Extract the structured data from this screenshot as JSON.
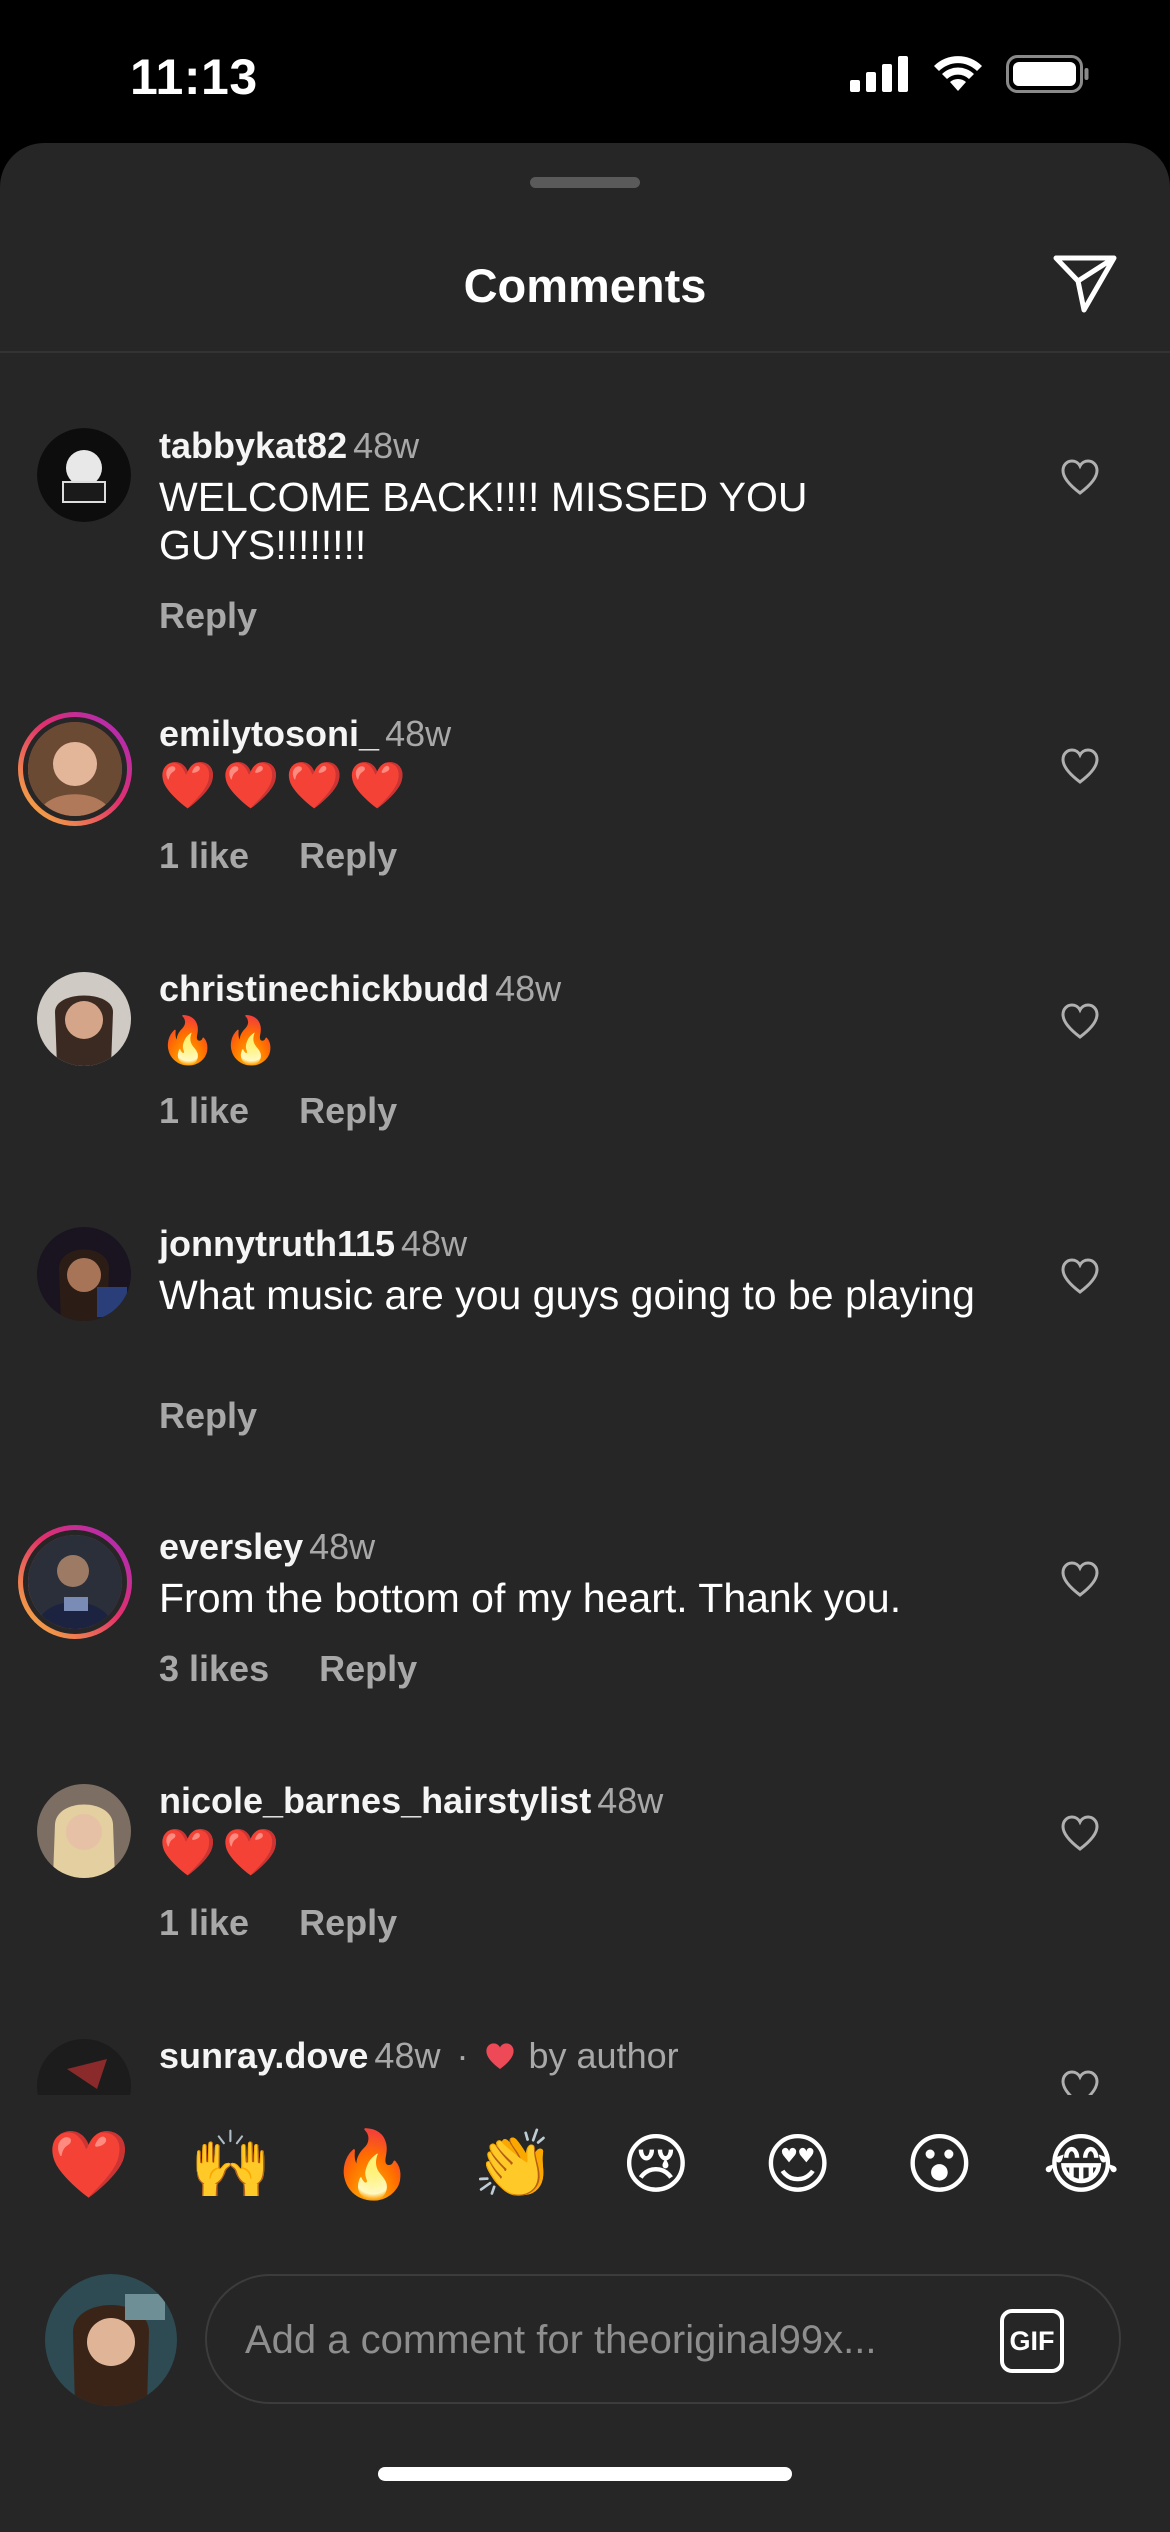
{
  "status": {
    "time": "11:13"
  },
  "sheet": {
    "title": "Comments"
  },
  "comments": [
    {
      "user": "tabbykat82",
      "time": "48w",
      "text": "WELCOME BACK!!!! MISSED YOU GUYS!!!!!!!!",
      "likes": "",
      "reply": "Reply"
    },
    {
      "user": "emilytosoni_",
      "time": "48w",
      "text": "❤️❤️❤️❤️",
      "likes": "1 like",
      "reply": "Reply"
    },
    {
      "user": "christinechickbudd",
      "time": "48w",
      "text": "🔥🔥",
      "likes": "1 like",
      "reply": "Reply"
    },
    {
      "user": "jonnytruth115",
      "time": "48w",
      "text": "What music are you guys going to be playing",
      "likes": "",
      "reply": "Reply"
    },
    {
      "user": "eversley",
      "time": "48w",
      "text": "From the bottom of my heart. Thank you.",
      "likes": "3 likes",
      "reply": "Reply"
    },
    {
      "user": "nicole_barnes_hairstylist",
      "time": "48w",
      "text": "❤️❤️",
      "likes": "1 like",
      "reply": "Reply"
    },
    {
      "user": "sunray.dove",
      "time": "48w",
      "badge_prefix": "·",
      "badge_text": "by author"
    }
  ],
  "reactions": [
    "❤️",
    "🙌",
    "🔥",
    "👏",
    "😢",
    "😍",
    "😮",
    "😂"
  ],
  "composer": {
    "placeholder": "Add a comment for theoriginal99x...",
    "gif_label": "GIF"
  },
  "colors": {
    "sheet": "#262626",
    "muted": "#a8a8a8",
    "heart_red": "#ed4956"
  }
}
